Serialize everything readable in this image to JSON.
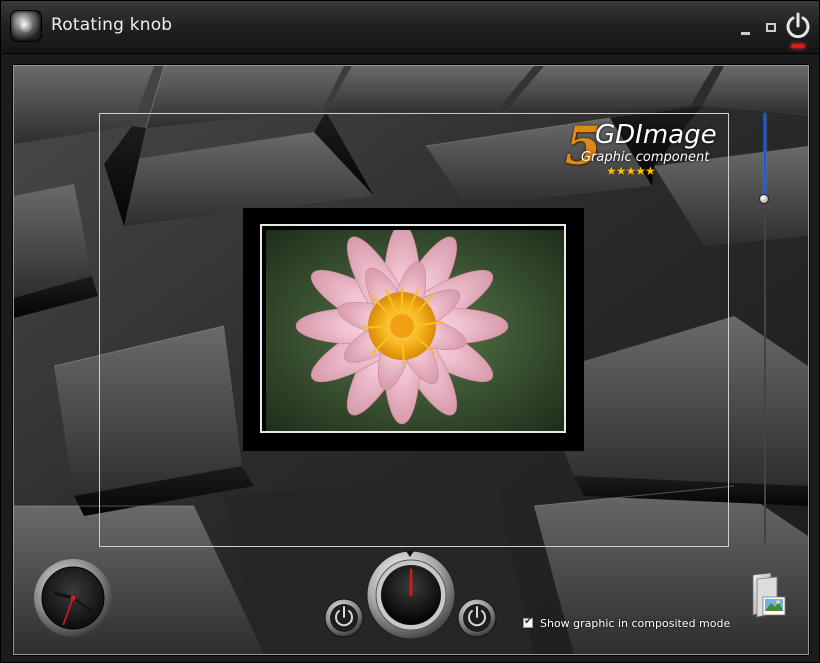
{
  "window": {
    "title": "Rotating knob",
    "accent_color": "#1e5bd8",
    "power_led_color": "#e01818"
  },
  "titlebar": {
    "icons": [
      "app-knob-icon",
      "minimize-icon",
      "maximize-icon",
      "power-icon"
    ]
  },
  "logo": {
    "mark": "5",
    "name": "GDImage",
    "subtitle": "Graphic component",
    "stars": "★★★★★",
    "rating": 5
  },
  "slider": {
    "orientation": "vertical",
    "value_fraction": 0.2
  },
  "clock": {
    "hour_hand_deg": 285,
    "minute_hand_deg": 125,
    "second_hand_deg": 200
  },
  "knob": {
    "indicator_deg": 0,
    "left_button_icon": "power-icon",
    "right_button_icon": "power-icon"
  },
  "composited_mode": {
    "label": "Show graphic in composited mode",
    "checked": true
  },
  "icons": {
    "pictures": "pictures-folder-icon"
  }
}
